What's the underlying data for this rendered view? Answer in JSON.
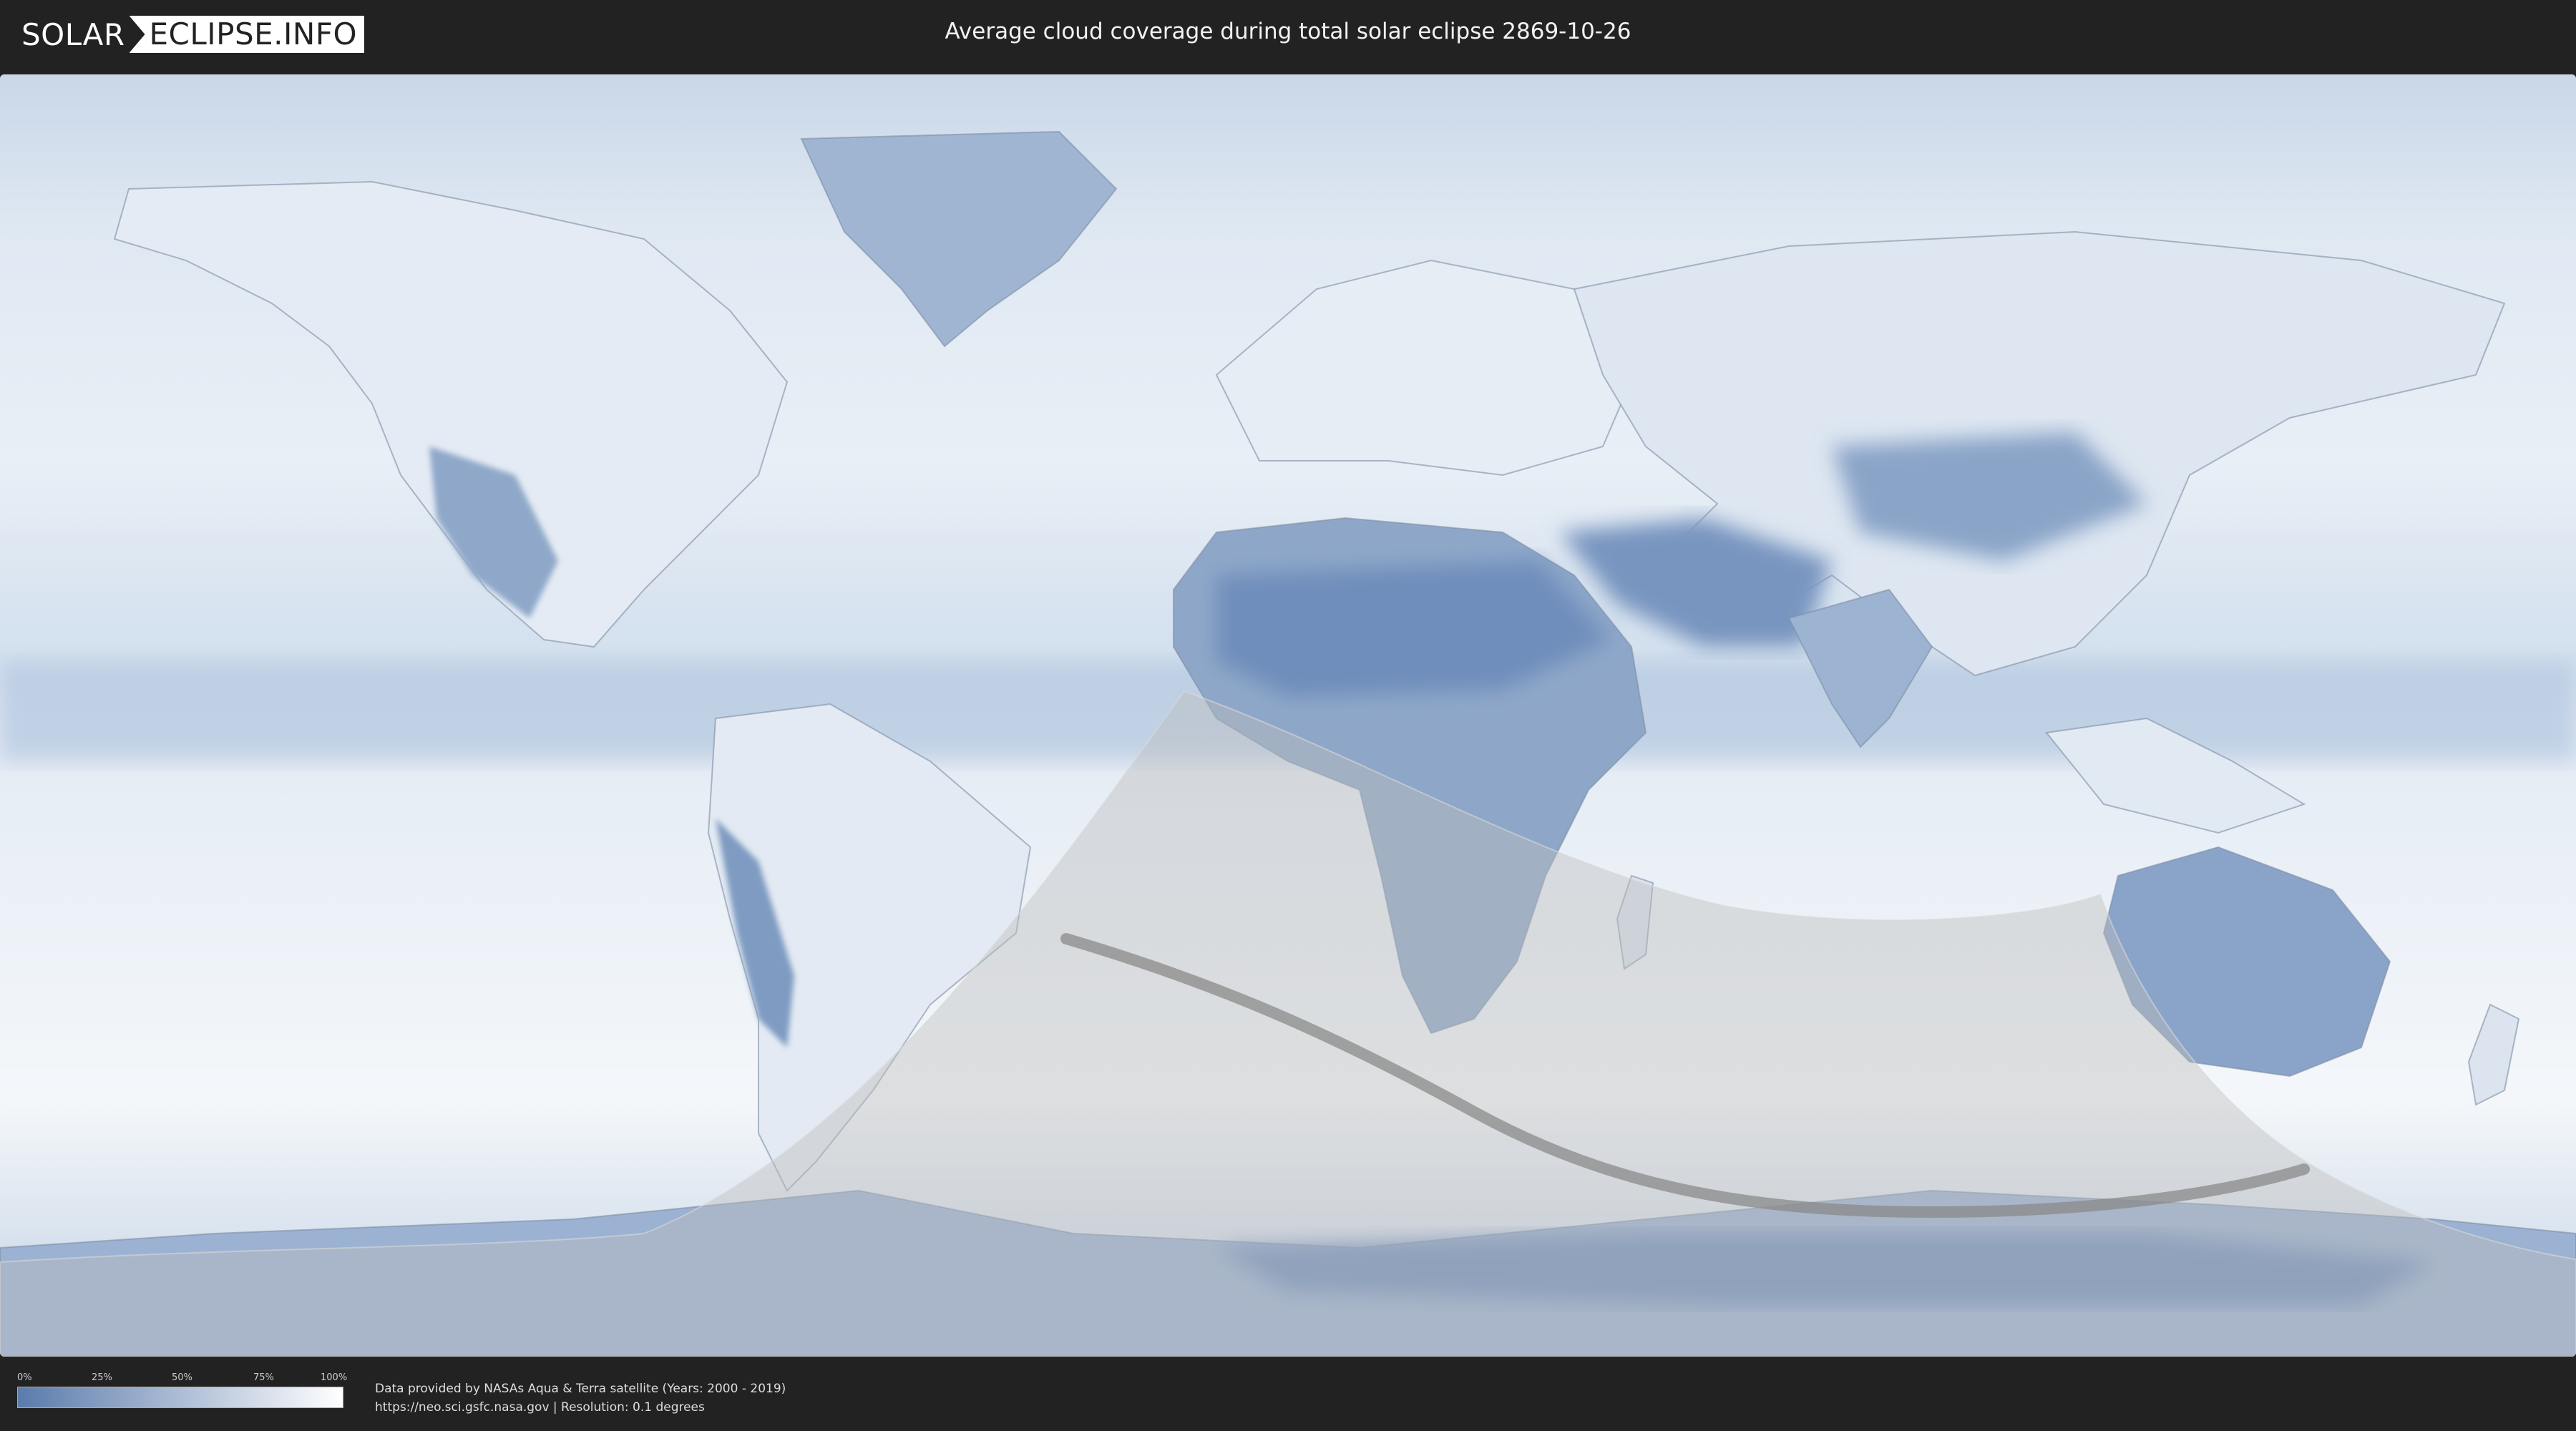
{
  "header": {
    "logo_part1": "SOLAR",
    "logo_part2": "ECLIPSE.INFO",
    "title": "Average cloud coverage during total solar eclipse 2869-10-26"
  },
  "legend": {
    "ticks": [
      "0%",
      "25%",
      "50%",
      "75%",
      "100%"
    ],
    "color_low": "#5b7bab",
    "color_high": "#ffffff"
  },
  "footer": {
    "source_line1": "Data provided by NASAs Aqua & Terra satellite (Years: 2000 - 2019)",
    "source_line2": "https://neo.sci.gsfc.nasa.gov | Resolution: 0.1 degrees"
  },
  "colors": {
    "background": "#222222",
    "cloud_clear": "#6f8fbe",
    "cloud_full": "#ffffff",
    "eclipse_zone": "#bcbcbc",
    "totality_path": "#8a8a8a"
  }
}
